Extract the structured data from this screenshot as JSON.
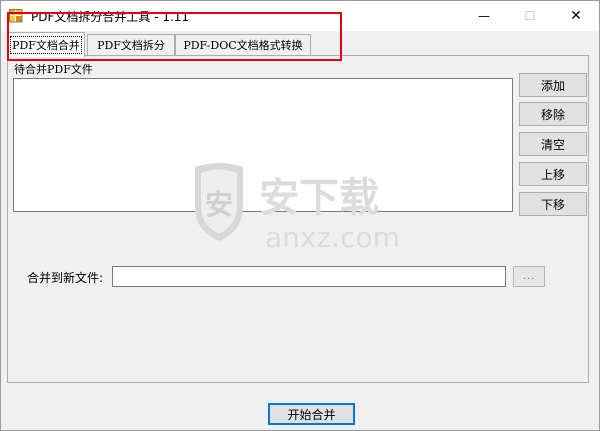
{
  "window": {
    "title": "PDF文档拆分合并工具 - 1.11",
    "minimize_glyph": "—",
    "maximize_glyph": "☐",
    "close_glyph": "✕"
  },
  "tabs": [
    {
      "label": "PDF文档合并",
      "active": true
    },
    {
      "label": "PDF文档拆分",
      "active": false
    },
    {
      "label": "PDF-DOC文档格式转换",
      "active": false
    }
  ],
  "merge_page": {
    "group_label": "待合并PDF文件",
    "files": [],
    "buttons": {
      "add": "添加",
      "remove": "移除",
      "clear": "清空",
      "move_up": "上移",
      "move_down": "下移"
    },
    "output_label": "合并到新文件:",
    "output_value": "",
    "browse_label": "...",
    "start_label": "开始合并"
  },
  "watermark": {
    "brand": "安下载",
    "domain": "anxz.com",
    "badge": "安"
  },
  "colors": {
    "annotation_red": "#e60012",
    "focus_blue": "#0078d7",
    "window_bg": "#f0f0f0"
  }
}
